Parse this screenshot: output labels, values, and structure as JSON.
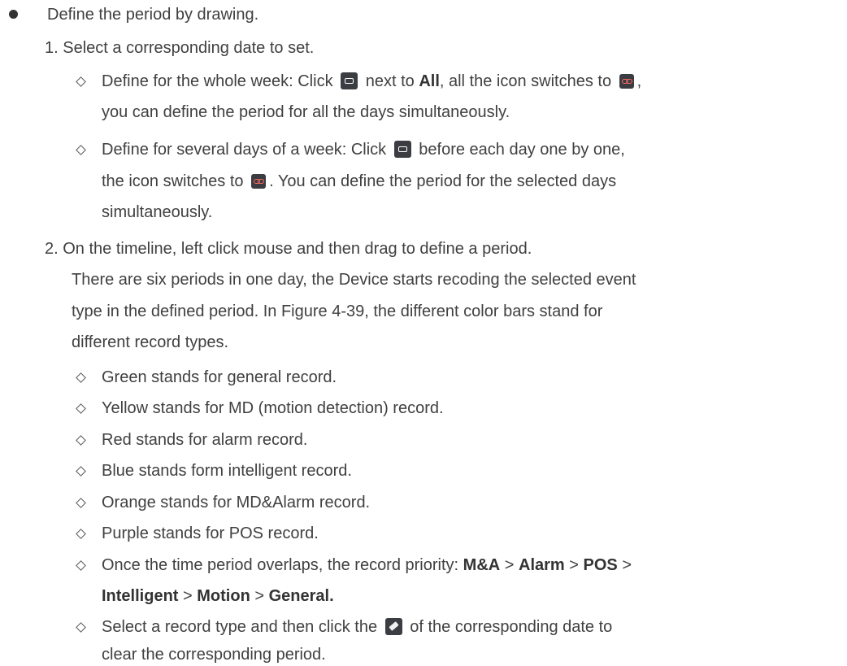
{
  "intro": {
    "text": "Define the period by drawing."
  },
  "step1": {
    "number": "1.",
    "text": "Select a corresponding date to set.",
    "sub": {
      "week_a": "Define for the whole week: Click",
      "week_b": "next to",
      "week_bold": "All",
      "week_c": ", all the icon switches to",
      "week_d": ",",
      "week_line2": "you can define the period for all the days simultaneously.",
      "days_a": "Define for several days of a week: Click",
      "days_b": "before each day one by one,",
      "days_c": "the icon switches to",
      "days_d": ". You can define the period for the selected days",
      "days_line3": "simultaneously."
    }
  },
  "step2": {
    "number": "2.",
    "text": "On the timeline, left click mouse and then drag to define a period.",
    "para_1": "There are six periods in one day, the Device starts recoding the selected event",
    "para_2": "type in the defined period. In Figure 4-39, the different color bars stand for",
    "para_3": "different record types.",
    "items": {
      "green": "Green stands for general record.",
      "yellow": "Yellow stands for MD (motion detection) record.",
      "red": "Red stands for alarm record.",
      "blue": "Blue stands form intelligent record.",
      "orange": "Orange stands for MD&Alarm record.",
      "purple": "Purple stands for POS record."
    },
    "priority": {
      "a": "Once the time period overlaps, the record priority:",
      "ma": "M&A",
      "gt": ">",
      "alarm": "Alarm",
      "pos": "POS",
      "intelligent": "Intelligent",
      "motion": "Motion",
      "general": "General."
    },
    "clear": {
      "a": "Select a record type and then click the",
      "b": "of the corresponding date to",
      "line2": "clear the corresponding period."
    }
  },
  "icons": {
    "unlinked": "unlinked-rect-icon",
    "linked": "linked-chain-icon",
    "eraser": "eraser-icon"
  },
  "colors": {
    "text": "#404040",
    "icon_bg": "#3b3d42",
    "link_accent": "#ff6a5e"
  }
}
